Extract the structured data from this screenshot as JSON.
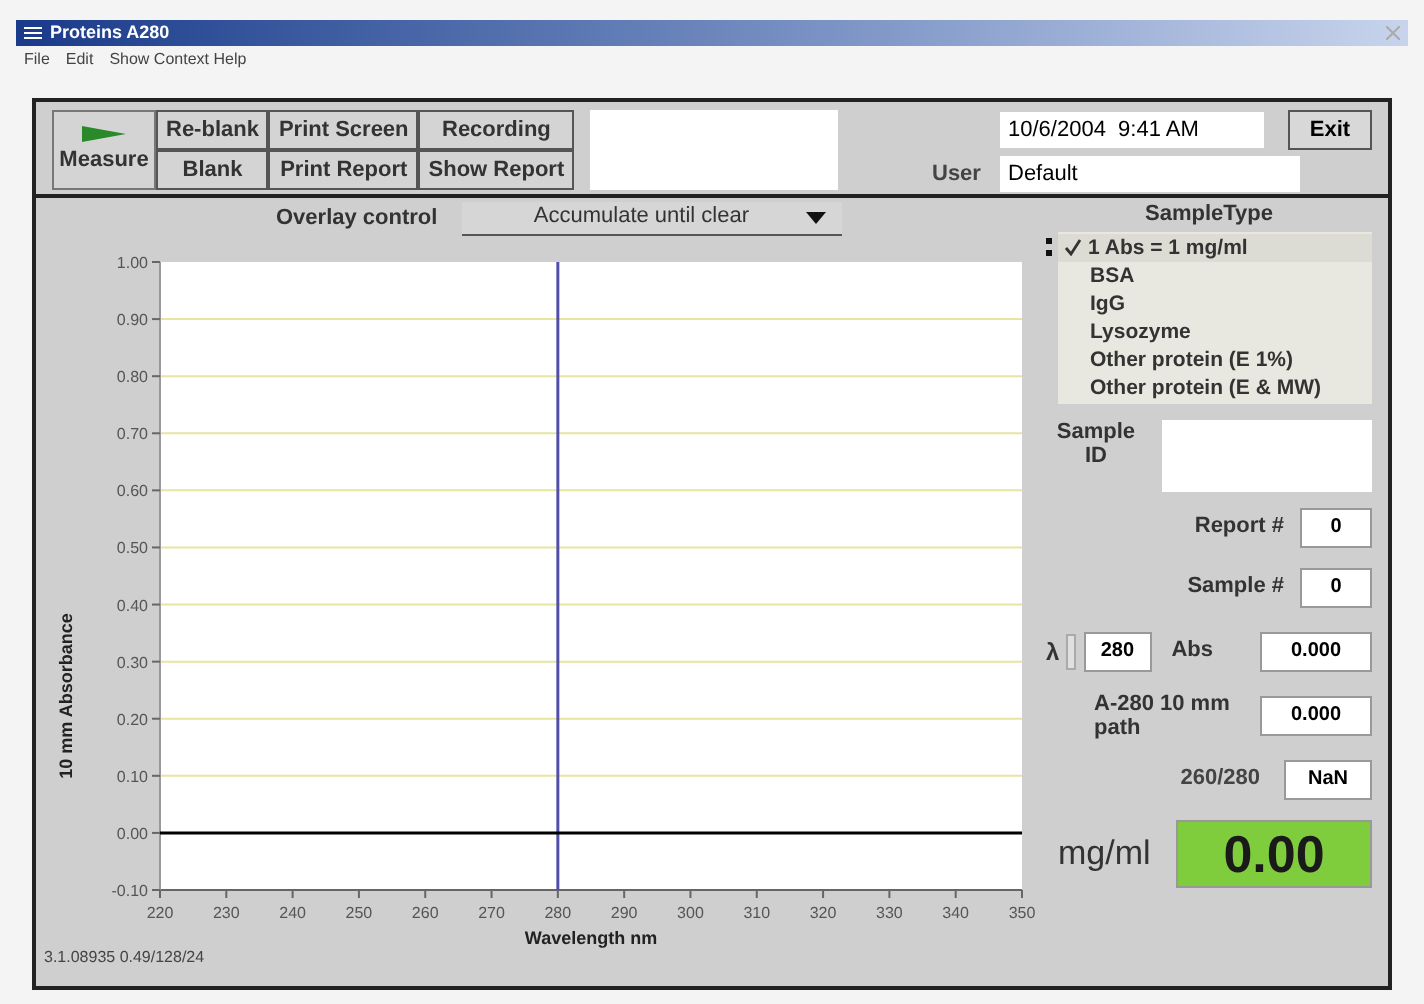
{
  "window": {
    "title": "Proteins A280"
  },
  "menu": [
    "File",
    "Edit",
    "Show Context Help"
  ],
  "toolbar": {
    "measure": "Measure",
    "buttons": [
      "Re-blank",
      "Print Screen",
      "Recording",
      "Blank",
      "Print Report",
      "Show Report"
    ],
    "datetime": "10/6/2004  9:41 AM",
    "exit": "Exit",
    "user_label": "User",
    "user": "Default"
  },
  "overlay": {
    "label": "Overlay control",
    "value": "Accumulate until clear"
  },
  "chart_data": {
    "type": "line",
    "xlabel": "Wavelength nm",
    "ylabel": "10 mm Absorbance",
    "x": [
      220,
      350
    ],
    "series": [
      {
        "color": "#000000",
        "values": [
          0,
          0
        ]
      }
    ],
    "grid": true,
    "xlim": [
      220,
      350
    ],
    "ylim": [
      -0.1,
      1.0
    ],
    "xticks": [
      220,
      230,
      240,
      250,
      260,
      270,
      280,
      290,
      300,
      310,
      320,
      330,
      340,
      350
    ],
    "yticks": [
      {
        "value": -0.1,
        "label": "-0.10"
      },
      {
        "value": 0,
        "label": "0.00"
      },
      {
        "value": 0.1,
        "label": "0.10"
      },
      {
        "value": 0.2,
        "label": "0.20"
      },
      {
        "value": 0.3,
        "label": "0.30"
      },
      {
        "value": 0.4,
        "label": "0.40"
      },
      {
        "value": 0.5,
        "label": "0.50"
      },
      {
        "value": 0.6,
        "label": "0.60"
      },
      {
        "value": 0.7,
        "label": "0.70"
      },
      {
        "value": 0.8,
        "label": "0.80"
      },
      {
        "value": 0.9,
        "label": "0.90"
      },
      {
        "value": 1.0,
        "label": "1.00"
      }
    ],
    "ref_lines": [
      {
        "axis": "x",
        "value": 280,
        "color": "#5050a8"
      }
    ]
  },
  "version": "3.1.08935 0.49/128/24",
  "sample_type": {
    "label": "SampleType",
    "options": [
      {
        "label": "1 Abs = 1 mg/ml",
        "selected": true
      },
      {
        "label": "BSA",
        "selected": false
      },
      {
        "label": "IgG",
        "selected": false
      },
      {
        "label": "Lysozyme",
        "selected": false
      },
      {
        "label": "Other protein (E 1%)",
        "selected": false
      },
      {
        "label": "Other protein (E & MW)",
        "selected": false
      }
    ]
  },
  "sample_id": {
    "label": "Sample ID"
  },
  "report": {
    "label": "Report #",
    "value": "0"
  },
  "sample": {
    "label": "Sample #",
    "value": "0"
  },
  "lambda": {
    "label": "λ",
    "value": "280"
  },
  "abs": {
    "label": "Abs",
    "value": "0.000"
  },
  "a280": {
    "label": "A-280 10 mm path",
    "value": "0.000"
  },
  "ratio": {
    "label": "260/280",
    "value": "NaN"
  },
  "concentration": {
    "label": "mg/ml",
    "value": "0.00"
  }
}
